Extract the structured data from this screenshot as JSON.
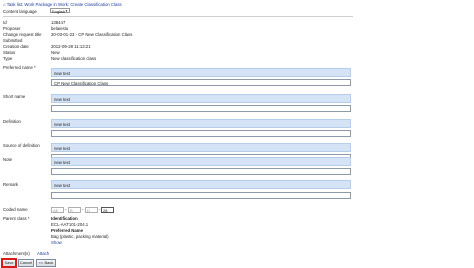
{
  "breadcrumb": {
    "home_icon": "home-icon",
    "text": "Task list: Work Package in Work: Create Classification Class"
  },
  "language": {
    "label": "Content language",
    "value": "English"
  },
  "info": [
    {
      "label": "Id",
      "value": "138447"
    },
    {
      "label": "Proposer",
      "value": "belaiestu"
    },
    {
      "label": "Change request title",
      "value": "20-03-01-23 - CP New Classification Class"
    },
    {
      "label": "Submitted",
      "value": ""
    },
    {
      "label": "Creation date",
      "value": "2012-09-28 11:13:21"
    },
    {
      "label": "Status",
      "value": "New"
    },
    {
      "label": "Type",
      "value": "New classification class"
    }
  ],
  "fields": {
    "preferred_name": {
      "label": "Preferred name *",
      "box_text": "new text",
      "input_value": "CP New Classification Class"
    },
    "short_name": {
      "label": "Short name",
      "box_text": "new text",
      "input_value": ""
    },
    "definition": {
      "label": "Definition",
      "box_text": "new text",
      "input_value": ""
    },
    "source_of_definition": {
      "label": "Source of definition",
      "box_text": "new text",
      "input_value": ""
    },
    "note": {
      "label": "Note",
      "box_text": "new text",
      "input_value": ""
    },
    "remark": {
      "label": "Remark",
      "box_text": "new text",
      "input_value": ""
    }
  },
  "coded_name": {
    "label": "Coded name",
    "values": [
      "AE",
      "B",
      "D",
      "28"
    ]
  },
  "parent_class": {
    "label": "Parent class *",
    "identification_label": "Identification",
    "identification_value": "ECL-AAT101-204.1",
    "preferred_name_label": "Preferred Name",
    "preferred_name_value": "Bag (plastic, packing material)",
    "link": "Show"
  },
  "attachments": {
    "label": "Attachment(s)",
    "link": "Attach"
  },
  "buttons": {
    "save": "Save",
    "cancel": "Cancel",
    "back": "<< Back"
  },
  "colors": {
    "field_box": "#d5e3f7",
    "link": "#1a3c9a",
    "save_highlight": "#d71b1b"
  }
}
